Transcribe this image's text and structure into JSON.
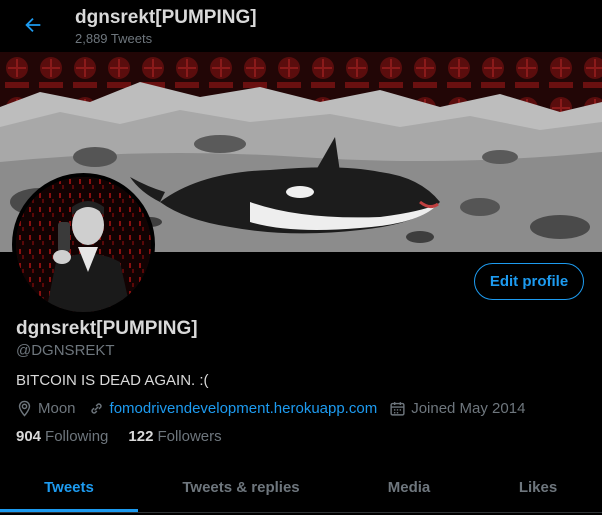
{
  "header": {
    "title": "dgnsrekt[PUMPING]",
    "tweet_count": "2,889 Tweets"
  },
  "banner": {
    "pattern_text": "FOMO"
  },
  "profile": {
    "display_name": "dgnsrekt[PUMPING]",
    "handle": "@DGNSREKT",
    "bio": "BITCOIN IS DEAD AGAIN. :(",
    "location": "Moon",
    "website": "fomodrivendevelopment.herokuapp.com",
    "joined": "Joined May 2014",
    "following_count": "904",
    "following_label": "Following",
    "followers_count": "122",
    "followers_label": "Followers",
    "edit_button": "Edit profile"
  },
  "tabs": [
    {
      "label": "Tweets",
      "active": true
    },
    {
      "label": "Tweets & replies",
      "active": false
    },
    {
      "label": "Media",
      "active": false
    },
    {
      "label": "Likes",
      "active": false
    }
  ],
  "colors": {
    "accent": "#1d9bf0",
    "background": "#000000",
    "muted": "#6e767d",
    "text": "#d9d9d9"
  }
}
